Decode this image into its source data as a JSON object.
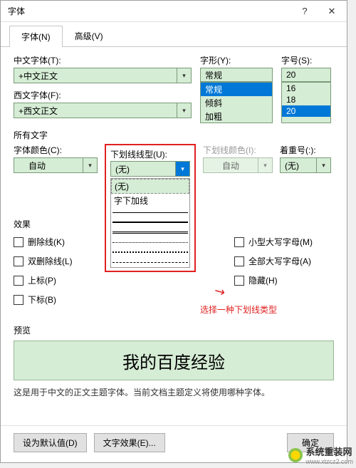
{
  "title": "字体",
  "tabs": {
    "font": "字体(N)",
    "advanced": "高级(V)"
  },
  "labels": {
    "cjk_font": "中文字体(T):",
    "latin_font": "西文字体(F):",
    "style": "字形(Y):",
    "size": "字号(S):",
    "all_text": "所有文字",
    "font_color": "字体颜色(C):",
    "underline_type": "下划线线型(U):",
    "underline_color": "下划线颜色(I):",
    "emphasis": "着重号(:):",
    "effects": "效果",
    "preview": "预览"
  },
  "values": {
    "cjk_font": "+中文正文",
    "latin_font": "+西文正文",
    "style": "常规",
    "size": "20",
    "font_color": "自动",
    "underline_type": "(无)",
    "underline_color": "自动",
    "emphasis": "(无)"
  },
  "style_options": [
    "常规",
    "倾斜",
    "加粗"
  ],
  "size_options": [
    "16",
    "18",
    "20"
  ],
  "underline_options": {
    "none": "(无)",
    "words_only": "字下加线"
  },
  "effects_left": {
    "strike": "删除线(K)",
    "double_strike": "双删除线(L)",
    "superscript": "上标(P)",
    "subscript": "下标(B)"
  },
  "effects_right": {
    "small_caps": "小型大写字母(M)",
    "all_caps": "全部大写字母(A)",
    "hidden": "隐藏(H)"
  },
  "annotation": "选择一种下划线类型",
  "preview_text": "我的百度经验",
  "preview_desc": "这是用于中文的正文主题字体。当前文档主题定义将使用哪种字体。",
  "footer": {
    "default": "设为默认值(D)",
    "text_effects": "文字效果(E)...",
    "ok": "确定"
  },
  "watermark": {
    "brand": "系统重装网",
    "url": "www.xtzcz2.com"
  }
}
